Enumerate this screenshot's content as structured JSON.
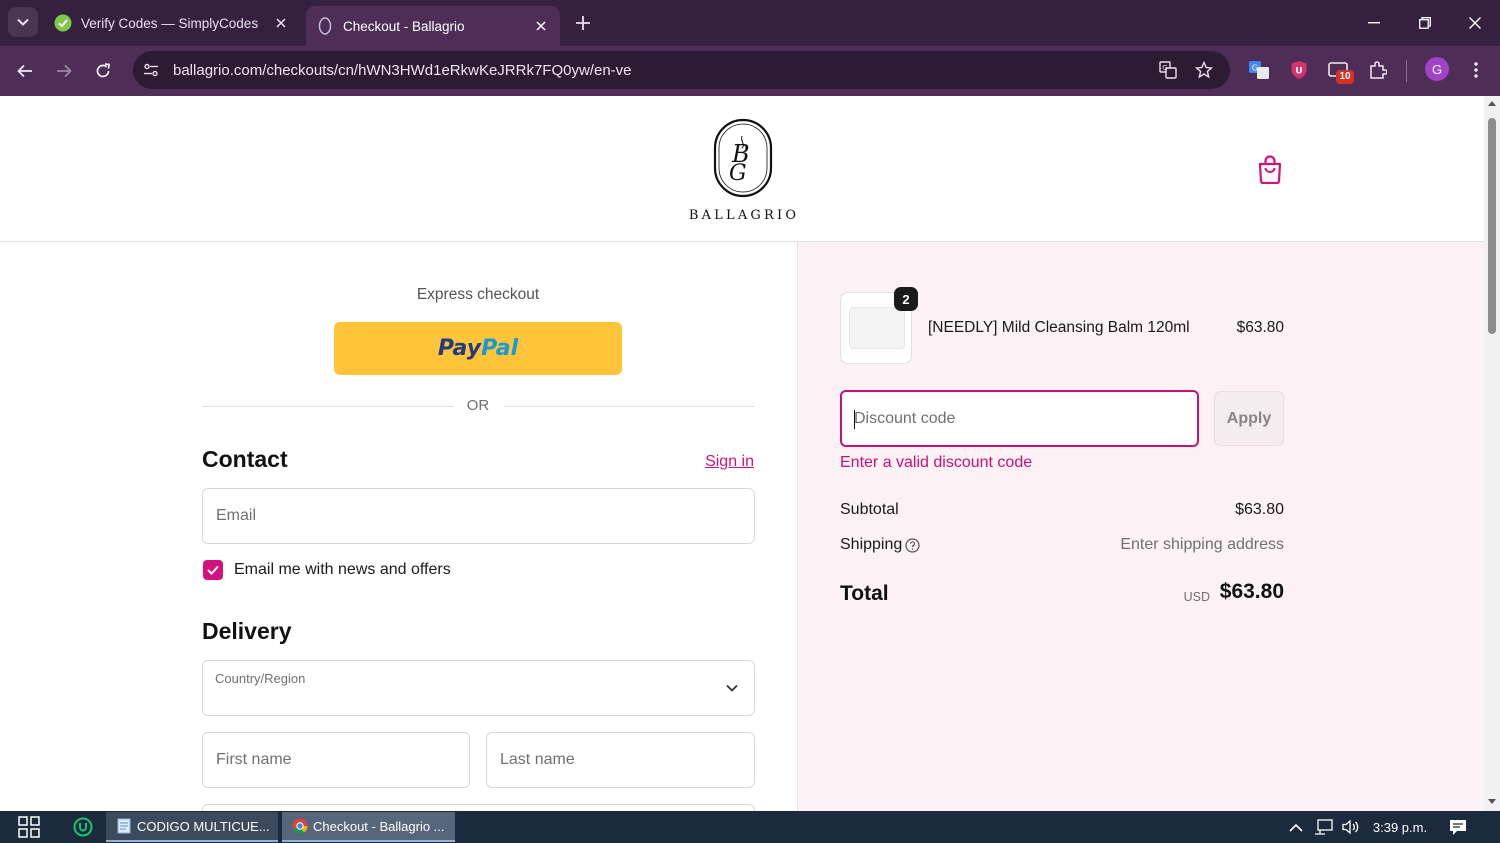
{
  "browser": {
    "tabs": [
      {
        "title": "Verify Codes — SimplyCodes",
        "active": false,
        "favicon": "simplycodes-icon"
      },
      {
        "title": "Checkout - Ballagrio",
        "active": true,
        "favicon": "ballagrio-icon"
      }
    ],
    "url": "ballagrio.com/checkouts/cn/hWN3HWd1eRkwKeJRRk7FQ0yw/en-ve",
    "extension_badge": "10",
    "profile_initial": "G"
  },
  "store": {
    "brand": "BALLAGRIO",
    "logo_monogram": "BG"
  },
  "checkout": {
    "express_label": "Express checkout",
    "paypal_label_1": "Pay",
    "paypal_label_2": "Pal",
    "or_label": "OR",
    "contact": {
      "title": "Contact",
      "sign_in": "Sign in",
      "email_placeholder": "Email",
      "newsletter_label": "Email me with news and offers",
      "newsletter_checked": true
    },
    "delivery": {
      "title": "Delivery",
      "country_label": "Country/Region",
      "first_name_placeholder": "First name",
      "last_name_placeholder": "Last name"
    }
  },
  "summary": {
    "item": {
      "name": "[NEEDLY] Mild Cleansing Balm 120ml",
      "quantity": "2",
      "price": "$63.80"
    },
    "discount_placeholder": "Discount code",
    "apply_label": "Apply",
    "discount_error": "Enter a valid discount code",
    "subtotal_label": "Subtotal",
    "subtotal_value": "$63.80",
    "shipping_label": "Shipping",
    "shipping_value": "Enter shipping address",
    "total_label": "Total",
    "total_currency": "USD",
    "total_value": "$63.80"
  },
  "taskbar": {
    "apps": [
      {
        "label": "CODIGO MULTICUE...",
        "icon": "notepad-icon"
      },
      {
        "label": "Checkout - Ballagrio ...",
        "icon": "chrome-icon"
      }
    ],
    "clock": "3:39 p.m."
  },
  "colors": {
    "accent": "#d2127b",
    "chrome_frame": "#35213f",
    "chrome_toolbar": "#4e2e56",
    "summary_bg": "#fcf1f4",
    "paypal_yellow": "#ffc439"
  }
}
